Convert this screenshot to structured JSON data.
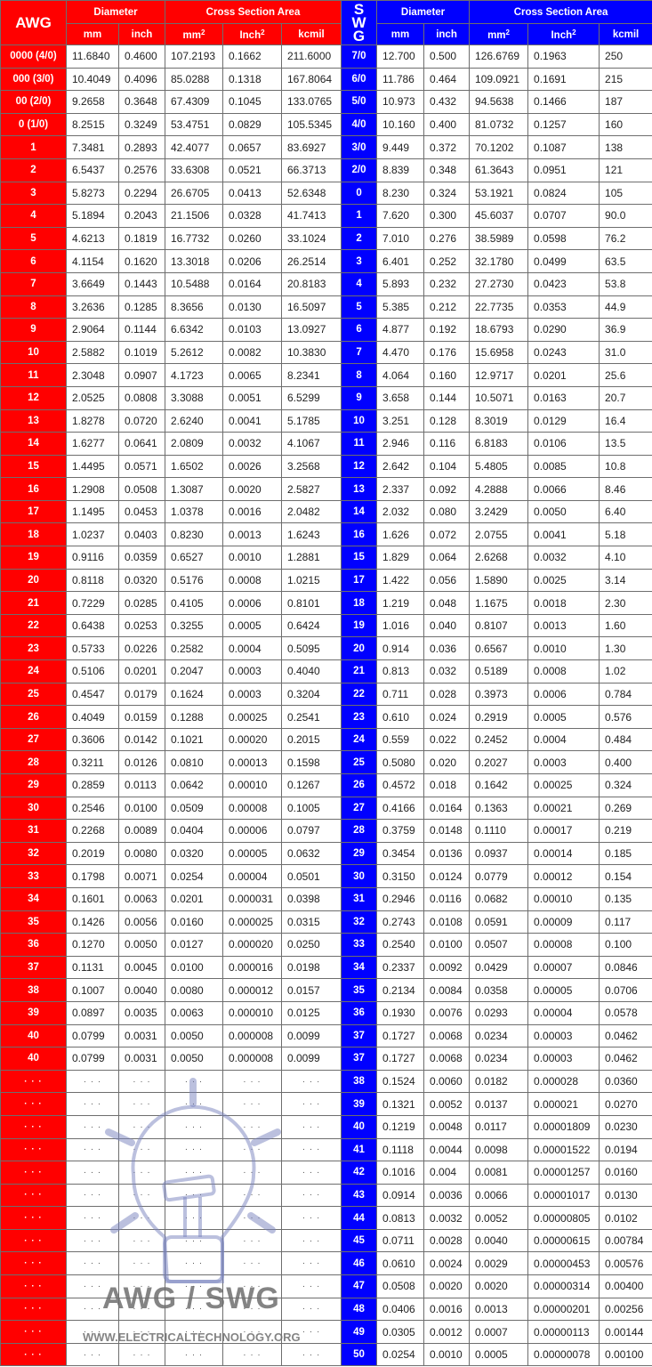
{
  "headers": {
    "awg": "AWG",
    "swg_letters": [
      "S",
      "W",
      "G"
    ],
    "diameter": "Diameter",
    "cross_section": "Cross Section Area",
    "mm": "mm",
    "inch": "inch",
    "mm2": "mm",
    "inch2": "Inch",
    "sup2": "2",
    "kcmil": "kcmil"
  },
  "watermark": {
    "title": "AWG / SWG",
    "url": "WWW.ELECTRICALTECHNOLOGY.ORG"
  },
  "colors": {
    "awg": "#ff0000",
    "swg": "#0000ff"
  },
  "rows": [
    {
      "awg": [
        "0000 (4/0)",
        "11.6840",
        "0.4600",
        "107.2193",
        "0.1662",
        "211.6000"
      ],
      "swg": [
        "7/0",
        "12.700",
        "0.500",
        "126.6769",
        "0.1963",
        "250"
      ]
    },
    {
      "awg": [
        "000 (3/0)",
        "10.4049",
        "0.4096",
        "85.0288",
        "0.1318",
        "167.8064"
      ],
      "swg": [
        "6/0",
        "11.786",
        "0.464",
        "109.0921",
        "0.1691",
        "215"
      ]
    },
    {
      "awg": [
        "00 (2/0)",
        "9.2658",
        "0.3648",
        "67.4309",
        "0.1045",
        "133.0765"
      ],
      "swg": [
        "5/0",
        "10.973",
        "0.432",
        "94.5638",
        "0.1466",
        "187"
      ]
    },
    {
      "awg": [
        "0 (1/0)",
        "8.2515",
        "0.3249",
        "53.4751",
        "0.0829",
        "105.5345"
      ],
      "swg": [
        "4/0",
        "10.160",
        "0.400",
        "81.0732",
        "0.1257",
        "160"
      ]
    },
    {
      "awg": [
        "1",
        "7.3481",
        "0.2893",
        "42.4077",
        "0.0657",
        "83.6927"
      ],
      "swg": [
        "3/0",
        "9.449",
        "0.372",
        "70.1202",
        "0.1087",
        "138"
      ]
    },
    {
      "awg": [
        "2",
        "6.5437",
        "0.2576",
        "33.6308",
        "0.0521",
        "66.3713"
      ],
      "swg": [
        "2/0",
        "8.839",
        "0.348",
        "61.3643",
        "0.0951",
        "121"
      ]
    },
    {
      "awg": [
        "3",
        "5.8273",
        "0.2294",
        "26.6705",
        "0.0413",
        "52.6348"
      ],
      "swg": [
        "0",
        "8.230",
        "0.324",
        "53.1921",
        "0.0824",
        "105"
      ]
    },
    {
      "awg": [
        "4",
        "5.1894",
        "0.2043",
        "21.1506",
        "0.0328",
        "41.7413"
      ],
      "swg": [
        "1",
        "7.620",
        "0.300",
        "45.6037",
        "0.0707",
        "90.0"
      ]
    },
    {
      "awg": [
        "5",
        "4.6213",
        "0.1819",
        "16.7732",
        "0.0260",
        "33.1024"
      ],
      "swg": [
        "2",
        "7.010",
        "0.276",
        "38.5989",
        "0.0598",
        "76.2"
      ]
    },
    {
      "awg": [
        "6",
        "4.1154",
        "0.1620",
        "13.3018",
        "0.0206",
        "26.2514"
      ],
      "swg": [
        "3",
        "6.401",
        "0.252",
        "32.1780",
        "0.0499",
        "63.5"
      ]
    },
    {
      "awg": [
        "7",
        "3.6649",
        "0.1443",
        "10.5488",
        "0.0164",
        "20.8183"
      ],
      "swg": [
        "4",
        "5.893",
        "0.232",
        "27.2730",
        "0.0423",
        "53.8"
      ]
    },
    {
      "awg": [
        "8",
        "3.2636",
        "0.1285",
        "8.3656",
        "0.0130",
        "16.5097"
      ],
      "swg": [
        "5",
        "5.385",
        "0.212",
        "22.7735",
        "0.0353",
        "44.9"
      ]
    },
    {
      "awg": [
        "9",
        "2.9064",
        "0.1144",
        "6.6342",
        "0.0103",
        "13.0927"
      ],
      "swg": [
        "6",
        "4.877",
        "0.192",
        "18.6793",
        "0.0290",
        "36.9"
      ]
    },
    {
      "awg": [
        "10",
        "2.5882",
        "0.1019",
        "5.2612",
        "0.0082",
        "10.3830"
      ],
      "swg": [
        "7",
        "4.470",
        "0.176",
        "15.6958",
        "0.0243",
        "31.0"
      ]
    },
    {
      "awg": [
        "11",
        "2.3048",
        "0.0907",
        "4.1723",
        "0.0065",
        "8.2341"
      ],
      "swg": [
        "8",
        "4.064",
        "0.160",
        "12.9717",
        "0.0201",
        "25.6"
      ]
    },
    {
      "awg": [
        "12",
        "2.0525",
        "0.0808",
        "3.3088",
        "0.0051",
        "6.5299"
      ],
      "swg": [
        "9",
        "3.658",
        "0.144",
        "10.5071",
        "0.0163",
        "20.7"
      ]
    },
    {
      "awg": [
        "13",
        "1.8278",
        "0.0720",
        "2.6240",
        "0.0041",
        "5.1785"
      ],
      "swg": [
        "10",
        "3.251",
        "0.128",
        "8.3019",
        "0.0129",
        "16.4"
      ]
    },
    {
      "awg": [
        "14",
        "1.6277",
        "0.0641",
        "2.0809",
        "0.0032",
        "4.1067"
      ],
      "swg": [
        "11",
        "2.946",
        "0.116",
        "6.8183",
        "0.0106",
        "13.5"
      ]
    },
    {
      "awg": [
        "15",
        "1.4495",
        "0.0571",
        "1.6502",
        "0.0026",
        "3.2568"
      ],
      "swg": [
        "12",
        "2.642",
        "0.104",
        "5.4805",
        "0.0085",
        "10.8"
      ]
    },
    {
      "awg": [
        "16",
        "1.2908",
        "0.0508",
        "1.3087",
        "0.0020",
        "2.5827"
      ],
      "swg": [
        "13",
        "2.337",
        "0.092",
        "4.2888",
        "0.0066",
        "8.46"
      ]
    },
    {
      "awg": [
        "17",
        "1.1495",
        "0.0453",
        "1.0378",
        "0.0016",
        "2.0482"
      ],
      "swg": [
        "14",
        "2.032",
        "0.080",
        "3.2429",
        "0.0050",
        "6.40"
      ]
    },
    {
      "awg": [
        "18",
        "1.0237",
        "0.0403",
        "0.8230",
        "0.0013",
        "1.6243"
      ],
      "swg": [
        "16",
        "1.626",
        "0.072",
        "2.0755",
        "0.0041",
        "5.18"
      ]
    },
    {
      "awg": [
        "19",
        "0.9116",
        "0.0359",
        "0.6527",
        "0.0010",
        "1.2881"
      ],
      "swg": [
        "15",
        "1.829",
        "0.064",
        "2.6268",
        "0.0032",
        "4.10"
      ]
    },
    {
      "awg": [
        "20",
        "0.8118",
        "0.0320",
        "0.5176",
        "0.0008",
        "1.0215"
      ],
      "swg": [
        "17",
        "1.422",
        "0.056",
        "1.5890",
        "0.0025",
        "3.14"
      ]
    },
    {
      "awg": [
        "21",
        "0.7229",
        "0.0285",
        "0.4105",
        "0.0006",
        "0.8101"
      ],
      "swg": [
        "18",
        "1.219",
        "0.048",
        "1.1675",
        "0.0018",
        "2.30"
      ]
    },
    {
      "awg": [
        "22",
        "0.6438",
        "0.0253",
        "0.3255",
        "0.0005",
        "0.6424"
      ],
      "swg": [
        "19",
        "1.016",
        "0.040",
        "0.8107",
        "0.0013",
        "1.60"
      ]
    },
    {
      "awg": [
        "23",
        "0.5733",
        "0.0226",
        "0.2582",
        "0.0004",
        "0.5095"
      ],
      "swg": [
        "20",
        "0.914",
        "0.036",
        "0.6567",
        "0.0010",
        "1.30"
      ]
    },
    {
      "awg": [
        "24",
        "0.5106",
        "0.0201",
        "0.2047",
        "0.0003",
        "0.4040"
      ],
      "swg": [
        "21",
        "0.813",
        "0.032",
        "0.5189",
        "0.0008",
        "1.02"
      ]
    },
    {
      "awg": [
        "25",
        "0.4547",
        "0.0179",
        "0.1624",
        "0.0003",
        "0.3204"
      ],
      "swg": [
        "22",
        "0.711",
        "0.028",
        "0.3973",
        "0.0006",
        "0.784"
      ]
    },
    {
      "awg": [
        "26",
        "0.4049",
        "0.0159",
        "0.1288",
        "0.00025",
        "0.2541"
      ],
      "swg": [
        "23",
        "0.610",
        "0.024",
        "0.2919",
        "0.0005",
        "0.576"
      ]
    },
    {
      "awg": [
        "27",
        "0.3606",
        "0.0142",
        "0.1021",
        "0.00020",
        "0.2015"
      ],
      "swg": [
        "24",
        "0.559",
        "0.022",
        "0.2452",
        "0.0004",
        "0.484"
      ]
    },
    {
      "awg": [
        "28",
        "0.3211",
        "0.0126",
        "0.0810",
        "0.00013",
        "0.1598"
      ],
      "swg": [
        "25",
        "0.5080",
        "0.020",
        "0.2027",
        "0.0003",
        "0.400"
      ]
    },
    {
      "awg": [
        "29",
        "0.2859",
        "0.0113",
        "0.0642",
        "0.00010",
        "0.1267"
      ],
      "swg": [
        "26",
        "0.4572",
        "0.018",
        "0.1642",
        "0.00025",
        "0.324"
      ]
    },
    {
      "awg": [
        "30",
        "0.2546",
        "0.0100",
        "0.0509",
        "0.00008",
        "0.1005"
      ],
      "swg": [
        "27",
        "0.4166",
        "0.0164",
        "0.1363",
        "0.00021",
        "0.269"
      ]
    },
    {
      "awg": [
        "31",
        "0.2268",
        "0.0089",
        "0.0404",
        "0.00006",
        "0.0797"
      ],
      "swg": [
        "28",
        "0.3759",
        "0.0148",
        "0.1110",
        "0.00017",
        "0.219"
      ]
    },
    {
      "awg": [
        "32",
        "0.2019",
        "0.0080",
        "0.0320",
        "0.00005",
        "0.0632"
      ],
      "swg": [
        "29",
        "0.3454",
        "0.0136",
        "0.0937",
        "0.00014",
        "0.185"
      ]
    },
    {
      "awg": [
        "33",
        "0.1798",
        "0.0071",
        "0.0254",
        "0.00004",
        "0.0501"
      ],
      "swg": [
        "30",
        "0.3150",
        "0.0124",
        "0.0779",
        "0.00012",
        "0.154"
      ]
    },
    {
      "awg": [
        "34",
        "0.1601",
        "0.0063",
        "0.0201",
        "0.000031",
        "0.0398"
      ],
      "swg": [
        "31",
        "0.2946",
        "0.0116",
        "0.0682",
        "0.00010",
        "0.135"
      ]
    },
    {
      "awg": [
        "35",
        "0.1426",
        "0.0056",
        "0.0160",
        "0.000025",
        "0.0315"
      ],
      "swg": [
        "32",
        "0.2743",
        "0.0108",
        "0.0591",
        "0.00009",
        "0.117"
      ]
    },
    {
      "awg": [
        "36",
        "0.1270",
        "0.0050",
        "0.0127",
        "0.000020",
        "0.0250"
      ],
      "swg": [
        "33",
        "0.2540",
        "0.0100",
        "0.0507",
        "0.00008",
        "0.100"
      ]
    },
    {
      "awg": [
        "37",
        "0.1131",
        "0.0045",
        "0.0100",
        "0.000016",
        "0.0198"
      ],
      "swg": [
        "34",
        "0.2337",
        "0.0092",
        "0.0429",
        "0.00007",
        "0.0846"
      ]
    },
    {
      "awg": [
        "38",
        "0.1007",
        "0.0040",
        "0.0080",
        "0.000012",
        "0.0157"
      ],
      "swg": [
        "35",
        "0.2134",
        "0.0084",
        "0.0358",
        "0.00005",
        "0.0706"
      ]
    },
    {
      "awg": [
        "39",
        "0.0897",
        "0.0035",
        "0.0063",
        "0.000010",
        "0.0125"
      ],
      "swg": [
        "36",
        "0.1930",
        "0.0076",
        "0.0293",
        "0.00004",
        "0.0578"
      ]
    },
    {
      "awg": [
        "40",
        "0.0799",
        "0.0031",
        "0.0050",
        "0.000008",
        "0.0099"
      ],
      "swg": [
        "37",
        "0.1727",
        "0.0068",
        "0.0234",
        "0.00003",
        "0.0462"
      ]
    },
    {
      "awg": [
        "40",
        "0.0799",
        "0.0031",
        "0.0050",
        "0.000008",
        "0.0099"
      ],
      "swg": [
        "37",
        "0.1727",
        "0.0068",
        "0.0234",
        "0.00003",
        "0.0462"
      ]
    },
    {
      "awg": [
        "...",
        "...",
        "...",
        "...",
        "...",
        "..."
      ],
      "swg": [
        "38",
        "0.1524",
        "0.0060",
        "0.0182",
        "0.000028",
        "0.0360"
      ]
    },
    {
      "awg": [
        "...",
        "...",
        "...",
        "...",
        "...",
        "..."
      ],
      "swg": [
        "39",
        "0.1321",
        "0.0052",
        "0.0137",
        "0.000021",
        "0.0270"
      ]
    },
    {
      "awg": [
        "...",
        "...",
        "...",
        "...",
        "...",
        "..."
      ],
      "swg": [
        "40",
        "0.1219",
        "0.0048",
        "0.0117",
        "0.00001809",
        "0.0230"
      ]
    },
    {
      "awg": [
        "...",
        "...",
        "...",
        "...",
        "...",
        "..."
      ],
      "swg": [
        "41",
        "0.1118",
        "0.0044",
        "0.0098",
        "0.00001522",
        "0.0194"
      ]
    },
    {
      "awg": [
        "...",
        "...",
        "...",
        "...",
        "...",
        "..."
      ],
      "swg": [
        "42",
        "0.1016",
        "0.004",
        "0.0081",
        "0.00001257",
        "0.0160"
      ]
    },
    {
      "awg": [
        "...",
        "...",
        "...",
        "...",
        "...",
        "..."
      ],
      "swg": [
        "43",
        "0.0914",
        "0.0036",
        "0.0066",
        "0.00001017",
        "0.0130"
      ]
    },
    {
      "awg": [
        "...",
        "...",
        "...",
        "...",
        "...",
        "..."
      ],
      "swg": [
        "44",
        "0.0813",
        "0.0032",
        "0.0052",
        "0.00000805",
        "0.0102"
      ]
    },
    {
      "awg": [
        "...",
        "...",
        "...",
        "...",
        "...",
        "..."
      ],
      "swg": [
        "45",
        "0.0711",
        "0.0028",
        "0.0040",
        "0.00000615",
        "0.00784"
      ]
    },
    {
      "awg": [
        "...",
        "...",
        "...",
        "...",
        "...",
        "..."
      ],
      "swg": [
        "46",
        "0.0610",
        "0.0024",
        "0.0029",
        "0.00000453",
        "0.00576"
      ]
    },
    {
      "awg": [
        "...",
        "...",
        "...",
        "...",
        "...",
        "..."
      ],
      "swg": [
        "47",
        "0.0508",
        "0.0020",
        "0.0020",
        "0.00000314",
        "0.00400"
      ]
    },
    {
      "awg": [
        "...",
        "...",
        "...",
        "...",
        "...",
        "..."
      ],
      "swg": [
        "48",
        "0.0406",
        "0.0016",
        "0.0013",
        "0.00000201",
        "0.00256"
      ]
    },
    {
      "awg": [
        "...",
        "...",
        "...",
        "...",
        "...",
        "..."
      ],
      "swg": [
        "49",
        "0.0305",
        "0.0012",
        "0.0007",
        "0.00000113",
        "0.00144"
      ]
    },
    {
      "awg": [
        "...",
        "...",
        "...",
        "...",
        "...",
        "..."
      ],
      "swg": [
        "50",
        "0.0254",
        "0.0010",
        "0.0005",
        "0.00000078",
        "0.00100"
      ]
    }
  ]
}
